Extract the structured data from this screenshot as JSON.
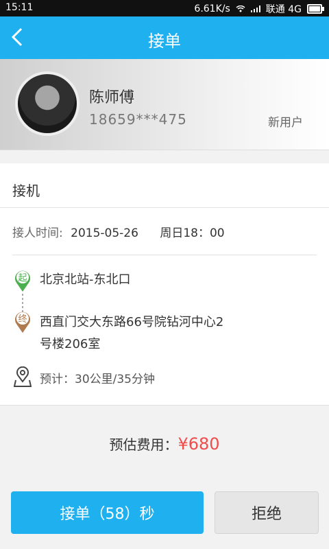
{
  "status_bar": {
    "time": "15:11",
    "speed": "6.61K/s",
    "carrier": "联通 4G"
  },
  "header": {
    "title": "接单",
    "back_icon": "chevron-left-icon"
  },
  "passenger": {
    "name": "陈师傅",
    "phone": "18659***475",
    "badge": "新用户"
  },
  "order": {
    "type": "接机",
    "time_label": "接人时间:",
    "date": "2015-05-26",
    "time": "周日18：00",
    "start_badge": "起",
    "start": "北京北站-东北口",
    "end_badge": "终",
    "end": "西直门交大东路66号院钻河中心2号楼206室",
    "estimate": "预计：30公里/35分钟"
  },
  "fee": {
    "label": "预估费用：",
    "amount": "¥680"
  },
  "actions": {
    "accept": "接单（58）秒",
    "reject": "拒绝"
  },
  "colors": {
    "accent": "#1fb1ef",
    "price": "#ef4c4c",
    "start_pin": "#4caf50",
    "end_pin": "#b07a4f"
  }
}
